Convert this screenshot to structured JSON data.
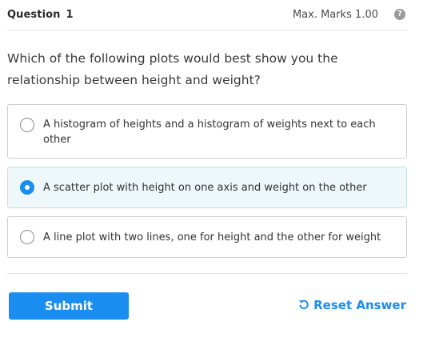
{
  "header": {
    "question_label": "Question",
    "question_number": "1",
    "max_marks": "Max. Marks 1.00",
    "help_icon": "help-icon"
  },
  "question": {
    "text": "Which of the following plots would best show you the relationship between height and weight?"
  },
  "options": [
    {
      "label": "A histogram of heights and a histogram of weights next to each other",
      "selected": false
    },
    {
      "label": "A scatter plot with height on one axis and weight on the other",
      "selected": true
    },
    {
      "label": "A line plot with two lines, one for height and the other for weight",
      "selected": false
    }
  ],
  "footer": {
    "submit_label": "Submit",
    "reset_label": "Reset Answer",
    "reset_icon": "undo-icon"
  },
  "colors": {
    "accent": "#1a8df0",
    "selected_bg": "#eef7f9"
  }
}
